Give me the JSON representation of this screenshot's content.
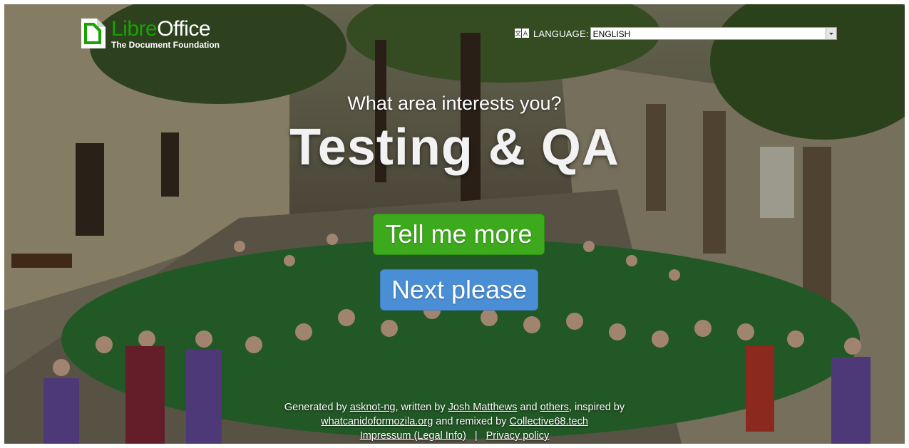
{
  "brand": {
    "name_part1": "Libre",
    "name_part2": "Office",
    "subtitle": "The Document Foundation",
    "accent_color": "#18a303"
  },
  "language": {
    "label": "LANGUAGE:",
    "selected": "ENGLISH",
    "icon": "translate-icon"
  },
  "hero": {
    "question": "What area interests you?",
    "area": "Testing & QA"
  },
  "buttons": {
    "more_label": "Tell me more",
    "more_color": "#3daa1d",
    "next_label": "Next please",
    "next_color": "#4a8fd6"
  },
  "footer": {
    "generated_by": "Generated by",
    "asknot": "asknot-ng",
    "written_by": ", written by",
    "josh": "Josh Matthews",
    "and": "and",
    "others": "others",
    "inspired_by": ", inspired by",
    "wcd": "whatcanidoformozila.org",
    "remixed_by": "and remixed by",
    "collective": "Collective68.tech",
    "impressum": "Impressum (Legal Info)",
    "separator": "|",
    "privacy": "Privacy policy"
  }
}
